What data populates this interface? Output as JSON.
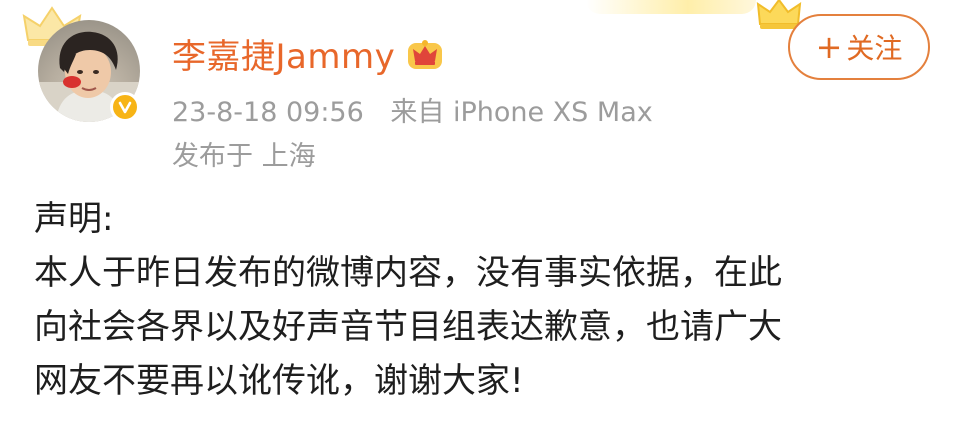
{
  "post": {
    "author": {
      "name": "李嘉捷Jammy"
    },
    "timestamp": "23-8-18 09:56",
    "source": "来自 iPhone XS Max",
    "location": "发布于 上海",
    "follow_label": "关注",
    "follow_plus": "+",
    "content_lines": [
      "声明:",
      "本人于昨日发布的微博内容，没有事实依据，在此",
      "向社会各界以及好声音节目组表达歉意，也请广大",
      "网友不要再以讹传讹，谢谢大家!"
    ]
  },
  "icons": [
    "crown-icon",
    "avatar",
    "verified-badge-icon",
    "vip-crown-icon"
  ],
  "colors": {
    "username": "#e8672a",
    "follow_border": "#e4803d",
    "meta_text": "#9c9c9c",
    "verified_badge": "#f7b416"
  }
}
